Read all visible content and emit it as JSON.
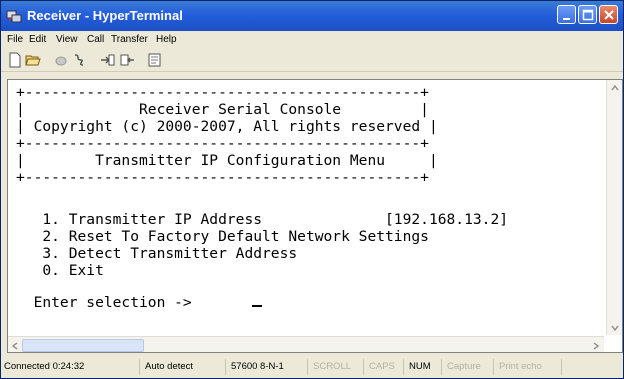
{
  "window": {
    "title": "Receiver - HyperTerminal"
  },
  "menu": [
    "File",
    "Edit",
    "View",
    "Call",
    "Transfer",
    "Help"
  ],
  "toolbar": [
    "new-icon",
    "open-icon",
    "disconnect-icon",
    "call-icon",
    "send-icon",
    "receive-icon",
    "properties-icon"
  ],
  "terminal": {
    "lines": [
      "+---------------------------------------------+",
      "|             Receiver Serial Console         |",
      "| Copyright (c) 2000-2007, All rights reserved |",
      "+---------------------------------------------+",
      "|        Transmitter IP Configuration Menu     |",
      "+---------------------------------------------+",
      "",
      "   1. Transmitter IP Address              [192.168.13.2]",
      "   2. Reset To Factory Default Network Settings",
      "   3. Detect Transmitter Address",
      "   0. Exit",
      "",
      "  Enter selection ->"
    ]
  },
  "status": {
    "connected": "Connected 0:24:32",
    "detect": "Auto detect",
    "params": "57600 8-N-1",
    "scroll": "SCROLL",
    "caps": "CAPS",
    "num": "NUM",
    "capture": "Capture",
    "print": "Print echo"
  }
}
